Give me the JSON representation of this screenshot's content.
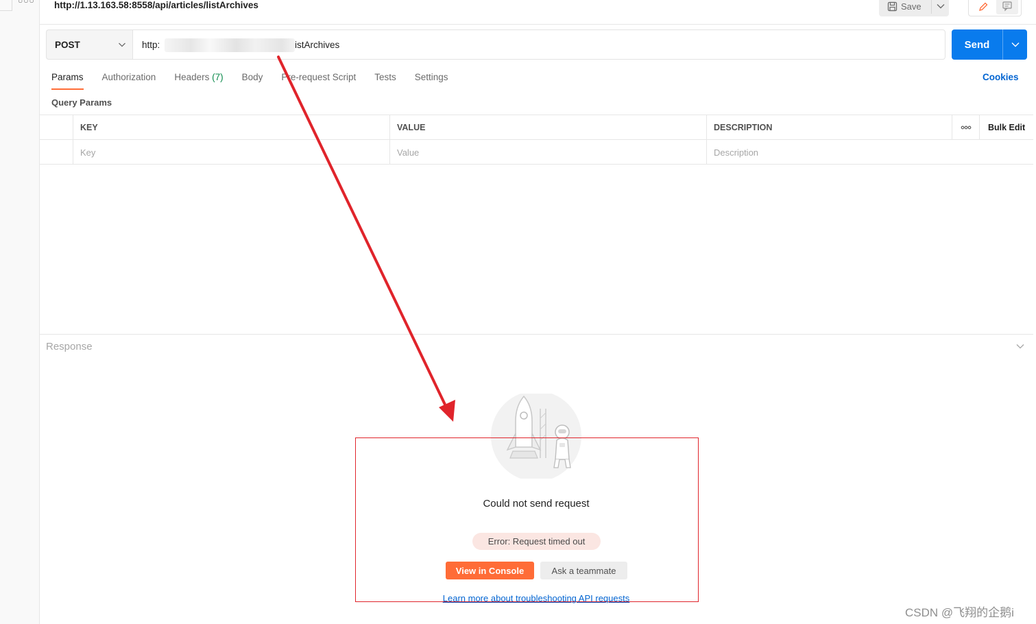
{
  "request": {
    "title": "http://1.13.163.58:8558/api/articles/listArchives",
    "method": "POST",
    "url_prefix": "http:",
    "url_suffix": "istArchives",
    "save_label": "Save",
    "send_label": "Send"
  },
  "tabs": [
    {
      "label": "Params",
      "active": true
    },
    {
      "label": "Authorization"
    },
    {
      "label": "Headers",
      "count": "(7)"
    },
    {
      "label": "Body"
    },
    {
      "label": "Pre-request Script"
    },
    {
      "label": "Tests"
    },
    {
      "label": "Settings"
    }
  ],
  "cookies_label": "Cookies",
  "query_params": {
    "title": "Query Params",
    "columns": {
      "key": "KEY",
      "value": "VALUE",
      "description": "DESCRIPTION",
      "bulk_edit": "Bulk Edit"
    },
    "placeholders": {
      "key": "Key",
      "value": "Value",
      "description": "Description"
    }
  },
  "response": {
    "title": "Response",
    "error_heading": "Could not send request",
    "error_message": "Error: Request timed out",
    "view_console": "View in Console",
    "ask_teammate": "Ask a teammate",
    "learn_more": "Learn more about troubleshooting API requests"
  },
  "watermark": "CSDN @飞翔的企鹅i",
  "colors": {
    "accent_orange": "#ff6c37",
    "send_blue": "#097bed",
    "link_blue": "#0265d2",
    "annotation_red": "#e0242b"
  }
}
